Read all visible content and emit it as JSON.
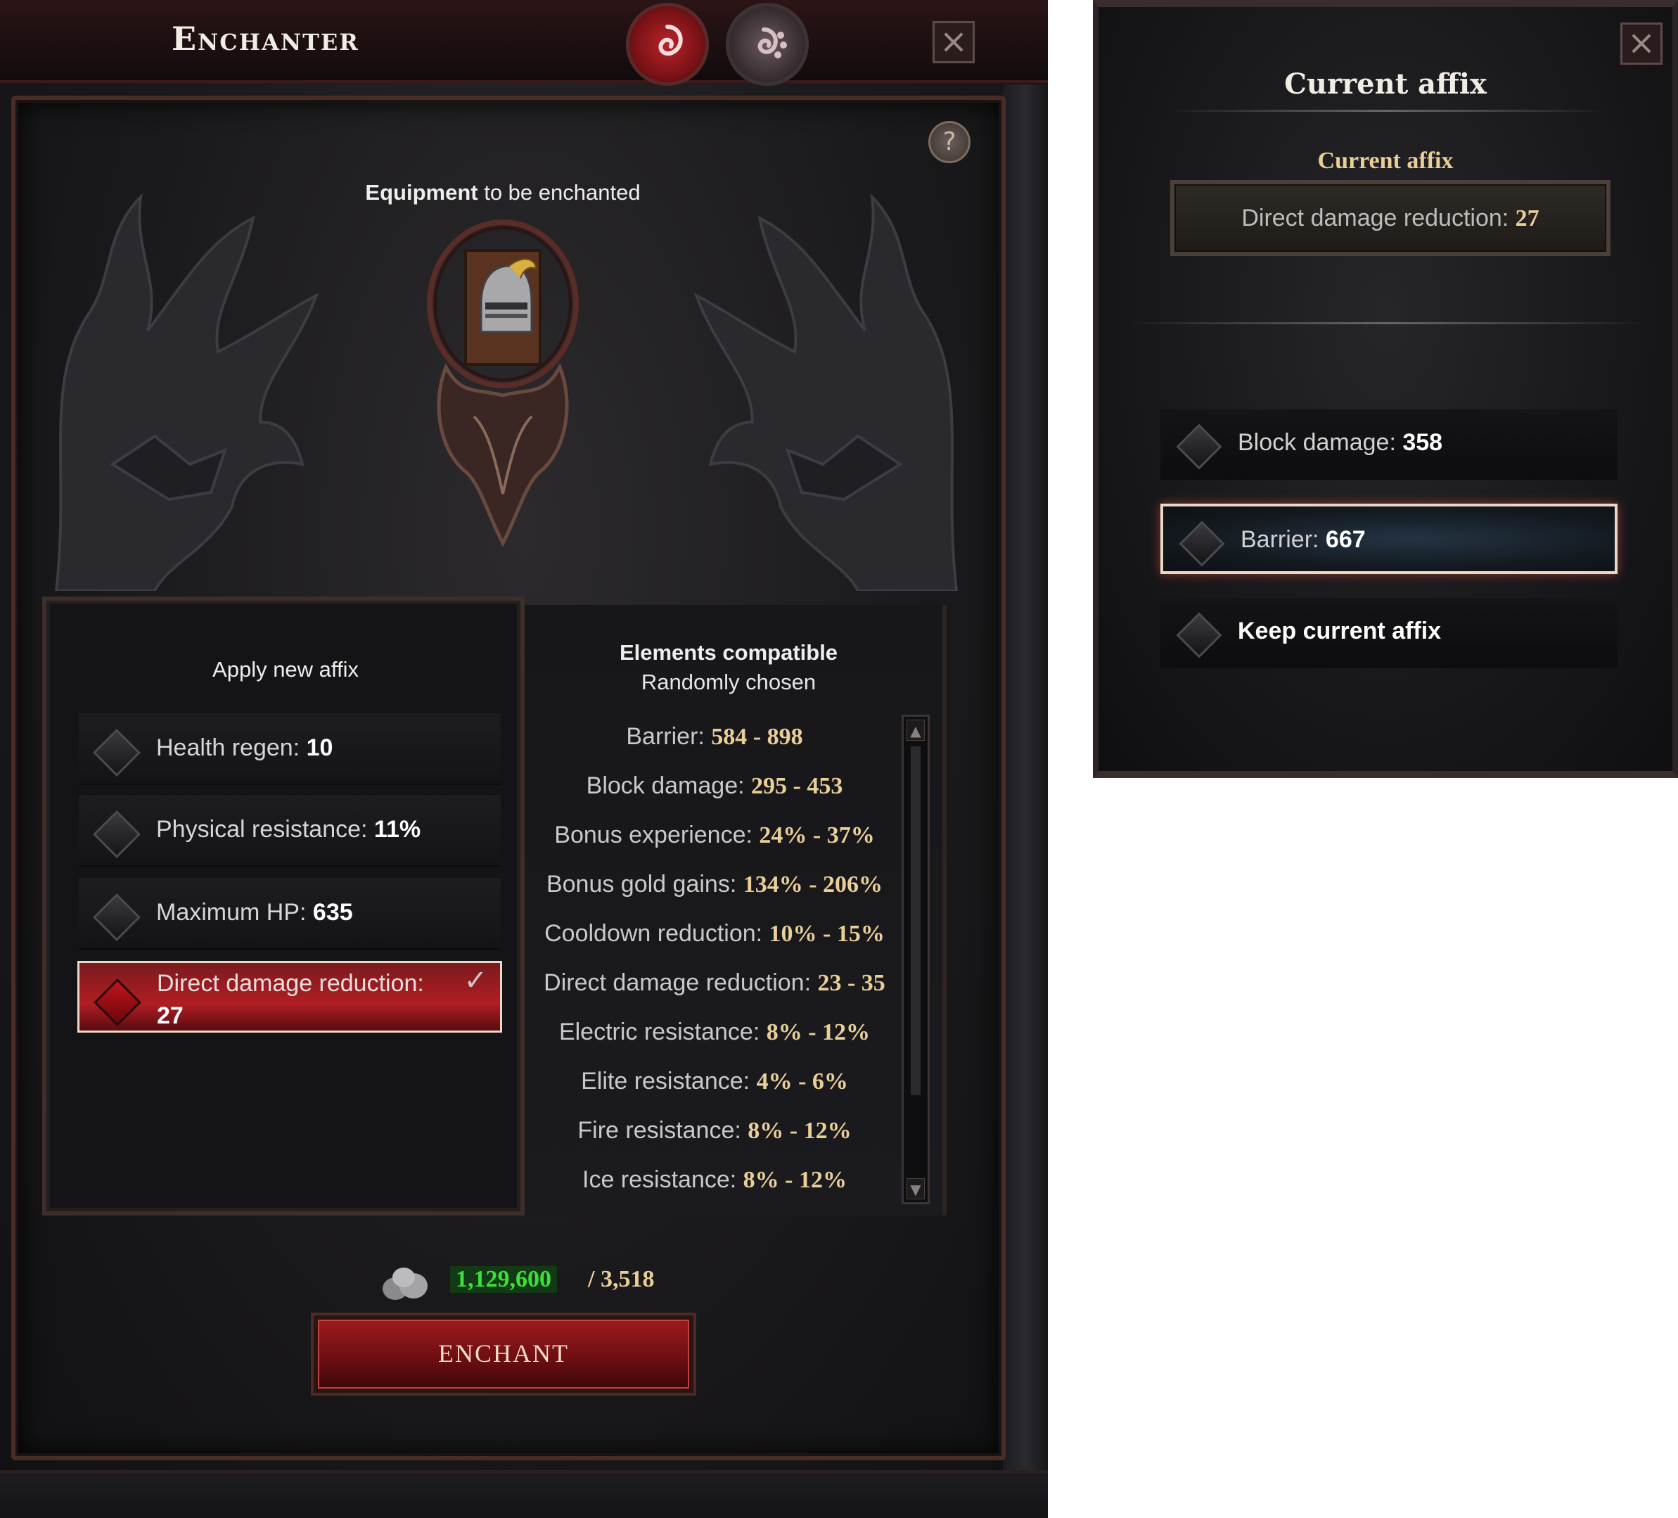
{
  "enchanter": {
    "title": "Enchanter",
    "close_icon": "×",
    "help_icon": "?",
    "equipment_label_bold": "Equipment",
    "equipment_label_rest": " to be enchanted",
    "apply_heading": "Apply new affix",
    "affixes": [
      {
        "label": "Health regen: ",
        "value": "10",
        "selected": false
      },
      {
        "label": "Physical resistance: ",
        "value": "11%",
        "selected": false
      },
      {
        "label": "Maximum HP: ",
        "value": "635",
        "selected": false
      },
      {
        "label": "Direct damage reduction:",
        "value": "27",
        "selected": true
      }
    ],
    "compatible_heading": "Elements compatible",
    "compatible_subheading": "Randomly chosen",
    "compatible": [
      {
        "label": "Barrier: ",
        "range": "584 - 898"
      },
      {
        "label": "Block damage: ",
        "range": "295 - 453"
      },
      {
        "label": "Bonus experience: ",
        "range": "24% - 37%"
      },
      {
        "label": "Bonus gold gains: ",
        "range": "134% - 206%"
      },
      {
        "label": "Cooldown reduction: ",
        "range": "10% - 15%"
      },
      {
        "label": "Direct damage reduction: ",
        "range": "23 - 35"
      },
      {
        "label": "Electric resistance: ",
        "range": "8% - 12%"
      },
      {
        "label": "Elite resistance: ",
        "range": "4% - 6%"
      },
      {
        "label": "Fire resistance: ",
        "range": "8% - 12%"
      },
      {
        "label": "Ice resistance: ",
        "range": "8% - 12%"
      }
    ],
    "cost_have": "1,129,600",
    "cost_need": "/ 3,518",
    "enchant_label": "ENCHANT"
  },
  "current_affix": {
    "title": "Current affix",
    "subtitle": "Current affix",
    "current_label": "Direct damage reduction: ",
    "current_value": "27",
    "close_icon": "×",
    "options": [
      {
        "label": "Block damage: ",
        "value": "358",
        "hover": false
      },
      {
        "label": "Barrier: ",
        "value": "667",
        "hover": true
      },
      {
        "label": "Keep current affix",
        "value": "",
        "hover": false
      }
    ]
  },
  "icons": {
    "tab_active": "spiral-rune-icon",
    "tab_inactive": "spiral-dots-rune-icon",
    "stones": "stone-pile-icon",
    "check": "checkmark-icon"
  },
  "colors": {
    "accent_red": "#b01e24",
    "gold_text": "#e9cf98",
    "currency_green": "#3ce03c"
  }
}
